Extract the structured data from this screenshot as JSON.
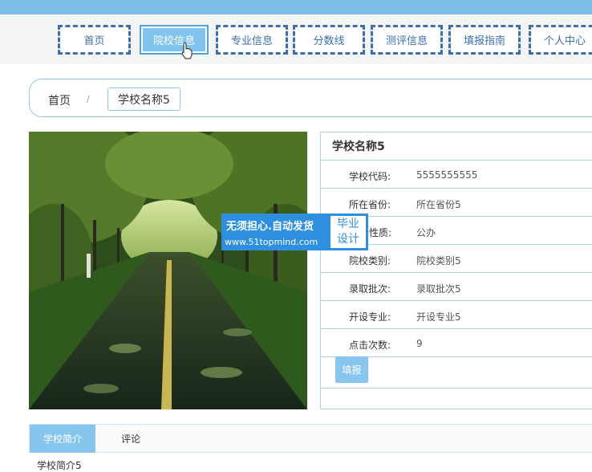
{
  "nav": {
    "items": [
      {
        "label": "首页"
      },
      {
        "label": "院校信息"
      },
      {
        "label": "专业信息"
      },
      {
        "label": "分数线"
      },
      {
        "label": "测评信息"
      },
      {
        "label": "填报指南"
      },
      {
        "label": "个人中心"
      }
    ],
    "active_index": 1
  },
  "breadcrumb": {
    "home": "首页",
    "separator": "/",
    "current": "学校名称5"
  },
  "school": {
    "title": "学校名称5",
    "rows": [
      {
        "label": "学校代码:",
        "value": "5555555555"
      },
      {
        "label": "所在省份:",
        "value": "所在省份5"
      },
      {
        "label": "性质:",
        "value": "公办"
      },
      {
        "label": "院校类别:",
        "value": "院校类别5"
      },
      {
        "label": "录取批次:",
        "value": "录取批次5"
      },
      {
        "label": "开设专业:",
        "value": "开设专业5"
      },
      {
        "label": "点击次数:",
        "value": "9"
      }
    ],
    "fill_button": "填报"
  },
  "watermark": {
    "line1": "无须担心.自动发货",
    "line2": "www.51topmind.com",
    "badge_line1": "毕业",
    "badge_line2": "设计"
  },
  "tabs": {
    "intro": "学校简介",
    "comments": "评论"
  },
  "intro_text": "学校简介5",
  "colors": {
    "accent": "#86c6ee",
    "nav_border": "#3b6fb0",
    "watermark": "#2e8fe0",
    "top_strip": "#7fbfe7"
  }
}
